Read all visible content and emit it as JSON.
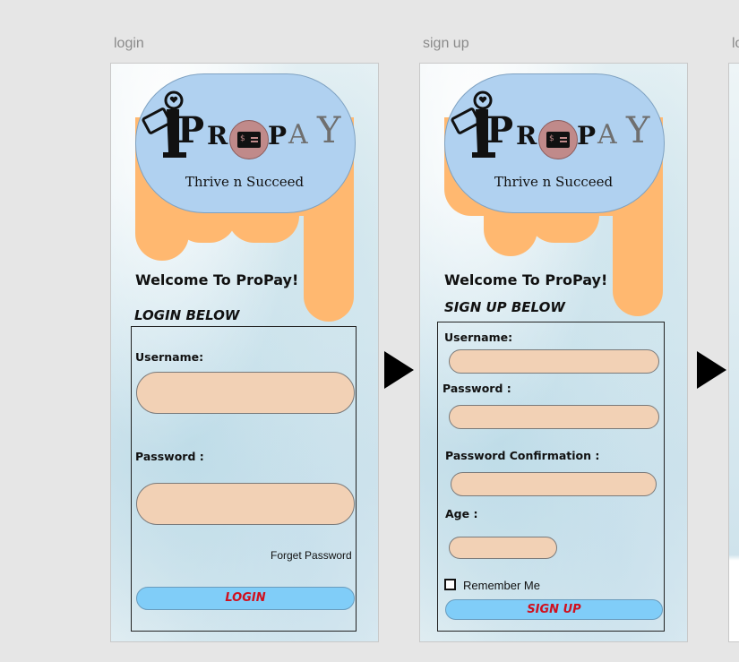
{
  "boards": {
    "login": {
      "label": "login",
      "tagline": "Thrive n Succeed",
      "welcome": "Welcome To ProPay!",
      "section_title": "LOGIN BELOW",
      "username_label": "Username:",
      "username_value": "",
      "password_label": "Password :",
      "password_value": "",
      "forget_password": "Forget Password",
      "login_button": "LOGIN"
    },
    "signup": {
      "label": "sign up",
      "tagline": "Thrive n Succeed",
      "welcome": "Welcome To ProPay!",
      "section_title": "SIGN UP BELOW",
      "username_label": "Username:",
      "username_value": "",
      "password_label": "Password :",
      "password_value": "",
      "confirm_label": "Password Confirmation :",
      "confirm_value": "",
      "age_label": "Age :",
      "age_value": "",
      "remember_label": "Remember Me",
      "remember_checked": false,
      "signup_button": "SIGN UP"
    },
    "third": {
      "label": "lo"
    }
  },
  "logo": {
    "letters_dark": [
      "P",
      "R",
      "P"
    ],
    "letters_grey": [
      "O",
      "A",
      "Y"
    ],
    "card_symbol": "$"
  },
  "colors": {
    "bubble": "#b0d1f0",
    "drip": "#ffb870",
    "field": "#f2d1b5",
    "button": "#80cdf8",
    "button_text": "#d0101e"
  },
  "icons": {
    "logo": "propay-logo-icon",
    "flow_arrow": "play-arrow-icon",
    "checkbox": "checkbox-icon"
  }
}
